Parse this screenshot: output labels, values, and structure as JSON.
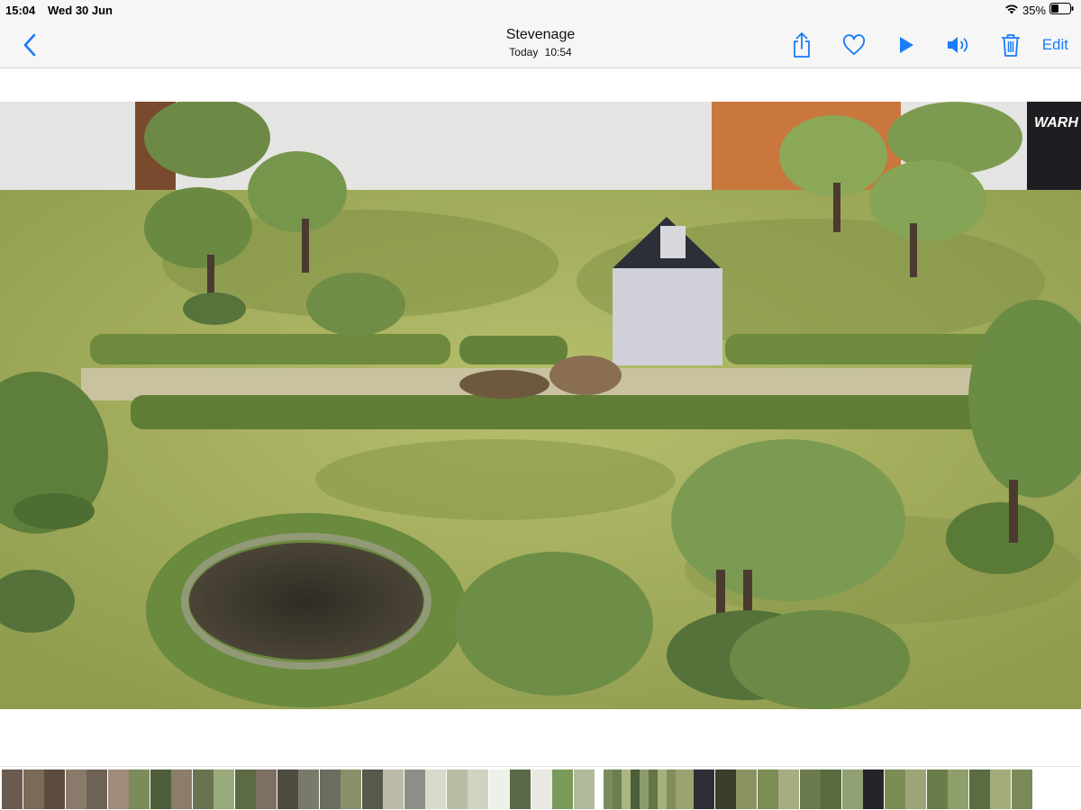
{
  "status_bar": {
    "time": "15:04",
    "date": "Wed 30 Jun",
    "battery": "35%",
    "icons": [
      "wifi-icon",
      "battery-icon"
    ]
  },
  "nav": {
    "title": "Stevenage",
    "subtitle_day": "Today",
    "subtitle_time": "10:54",
    "edit_label": "Edit",
    "icons": [
      "back-chevron-icon",
      "share-icon",
      "heart-icon",
      "play-icon",
      "speaker-icon",
      "trash-icon"
    ]
  },
  "colors": {
    "accent": "#1a7cf6",
    "bar_background": "#f6f6f6"
  },
  "photo": {
    "description_icon": "photo-image",
    "overlay_sign_text": "WARH"
  },
  "thumbnails": {
    "icon": "thumbnail-image",
    "colors": [
      "#6b5a4e",
      "#7b6a58",
      "#5d4b3f",
      "#8a7a6a",
      "#6e6256",
      "#a08b7a",
      "#7b8b5a",
      "#4f5e3a",
      "#8c7d6a",
      "#6a7350",
      "#99aa7a",
      "#5d6b45",
      "#7e6f63",
      "#4e4b40",
      "#7a7a6a",
      "#6c6c60",
      "#8b8f6a",
      "#555a4b",
      "#bdb9a8",
      "#8e8e88",
      "#d8dacb",
      "#b8bca5",
      "#cfd3c2",
      "#eef0ea",
      "#5a6a48",
      "#e8eae2",
      "#7a9a5a",
      "#b0b99a",
      "#7a8c5c",
      "#6c7d4f",
      "#a9b682",
      "#4d5e3a",
      "#8c9b6a",
      "#667547",
      "#a8b07d",
      "#7f8f5c",
      "#9aa26f",
      "#2e2e36",
      "#3a3f2c",
      "#8a9462",
      "#7c8e55",
      "#a6ad80",
      "#6b7b4f",
      "#5a6b40",
      "#90a072",
      "#252428",
      "#7b8d55",
      "#9ba575",
      "#6a7c4a",
      "#8f9f69",
      "#5b6c42",
      "#a3ad7b",
      "#7a8a57"
    ]
  }
}
